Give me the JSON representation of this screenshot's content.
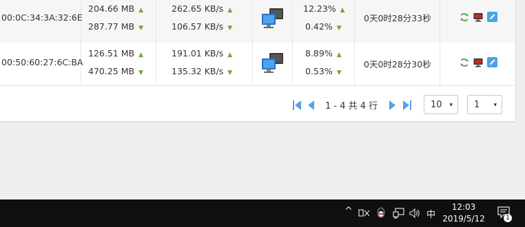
{
  "rows": [
    {
      "mac": "00:0C:34:3A:32:6E",
      "sent": "204.66 MB",
      "recv": "287.77 MB",
      "up_speed": "262.65 KB/s",
      "down_speed": "106.57 KB/s",
      "cpu": "12.23%",
      "mem": "0.42%",
      "uptime": "0天0时28分33秒"
    },
    {
      "mac": "00:50:60:27:6C:BA",
      "sent": "126.51 MB",
      "recv": "470.25 MB",
      "up_speed": "191.01 KB/s",
      "down_speed": "135.32 KB/s",
      "cpu": "8.89%",
      "mem": "0.53%",
      "uptime": "0天0时28分30秒"
    }
  ],
  "arrows": {
    "up": "▲",
    "down": "▼"
  },
  "pager": {
    "first": "⏮",
    "prev": "◀",
    "info": "1 - 4 共 4 行",
    "next": "▶",
    "last": "⏭",
    "page_size": "10",
    "page_number": "1",
    "caret": "▾"
  },
  "taskbar": {
    "chevron": "^",
    "ime": "中",
    "time": "12:03",
    "date": "2019/5/12",
    "notification_count": "1"
  },
  "colors": {
    "accent": "#5aa0e8",
    "refresh_icon": "#4caf50",
    "monitor_icon": "#c62828",
    "edit_icon": "#4aa3e8"
  }
}
